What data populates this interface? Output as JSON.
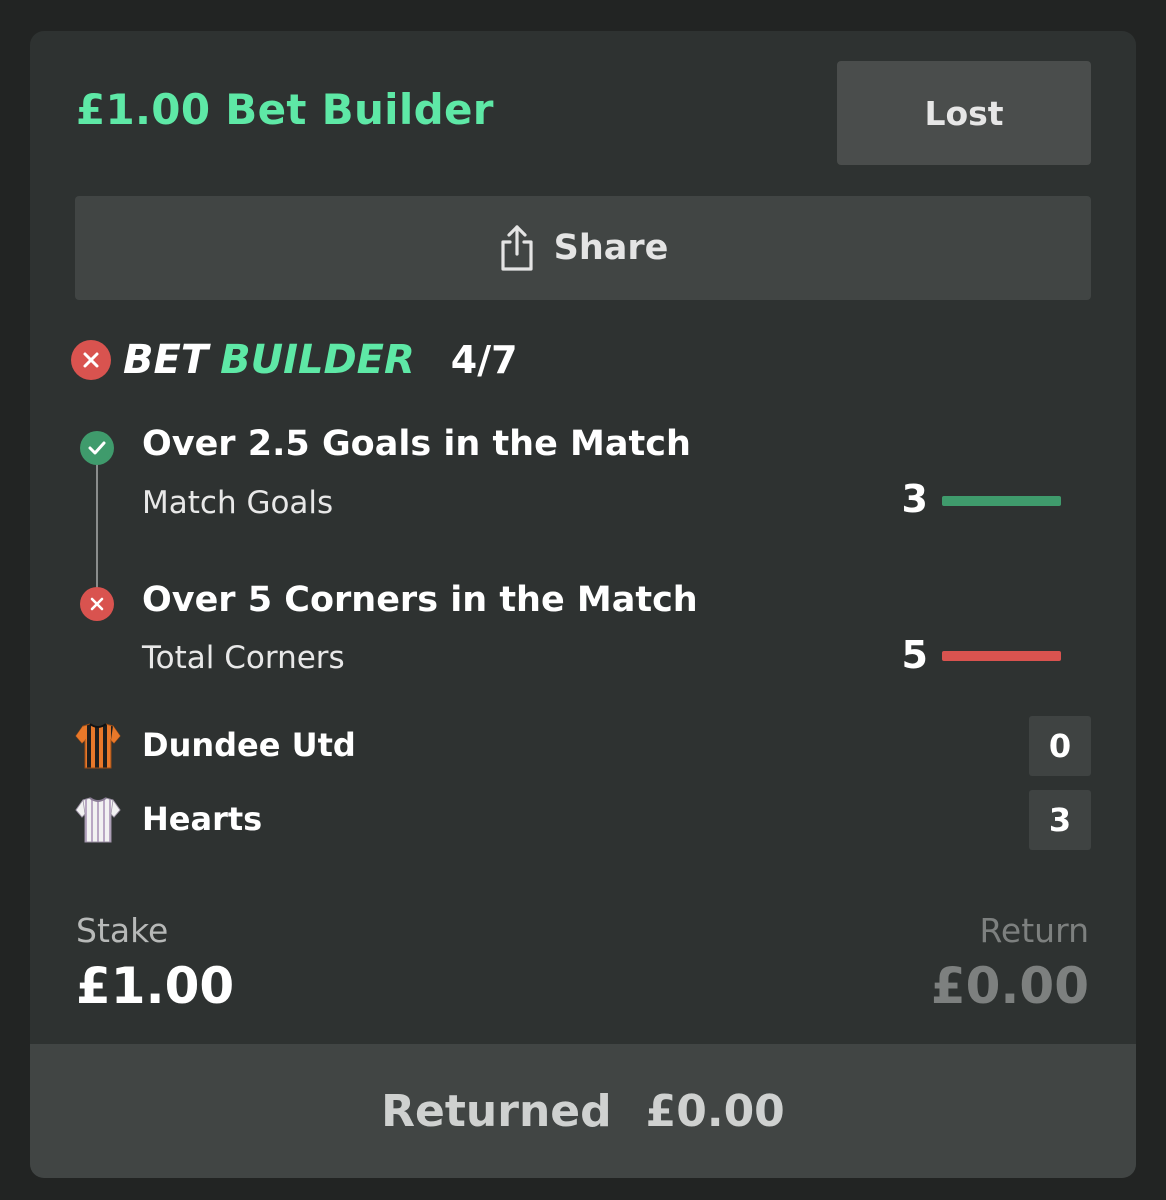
{
  "bet": {
    "title": "£1.00 Bet Builder",
    "status": "Lost"
  },
  "share": {
    "label": "Share",
    "icon": "share-icon"
  },
  "bet_builder": {
    "word1": "BET",
    "word2": "BUILDER",
    "odds": "4/7",
    "result_icon": "cross-icon"
  },
  "legs": [
    {
      "title": "Over 2.5 Goals in the Match",
      "market": "Match Goals",
      "stat": "3",
      "result": "won",
      "icon": "check-icon"
    },
    {
      "title": "Over 5 Corners in the Match",
      "market": "Total Corners",
      "stat": "5",
      "result": "lost",
      "icon": "cross-icon"
    }
  ],
  "teams": [
    {
      "name": "Dundee Utd",
      "score": "0",
      "kit": "orange-black-striped-shirt-icon"
    },
    {
      "name": "Hearts",
      "score": "3",
      "kit": "white-striped-shirt-icon"
    }
  ],
  "totals": {
    "stake_label": "Stake",
    "stake_value": "£1.00",
    "return_label": "Return",
    "return_value": "£0.00"
  },
  "footer": {
    "returned_label": "Returned",
    "returned_value": "£0.00"
  },
  "colors": {
    "accent": "#5ee8a6",
    "win": "#3f9b6c",
    "lose": "#d9534f",
    "card_bg": "#2e3231"
  }
}
